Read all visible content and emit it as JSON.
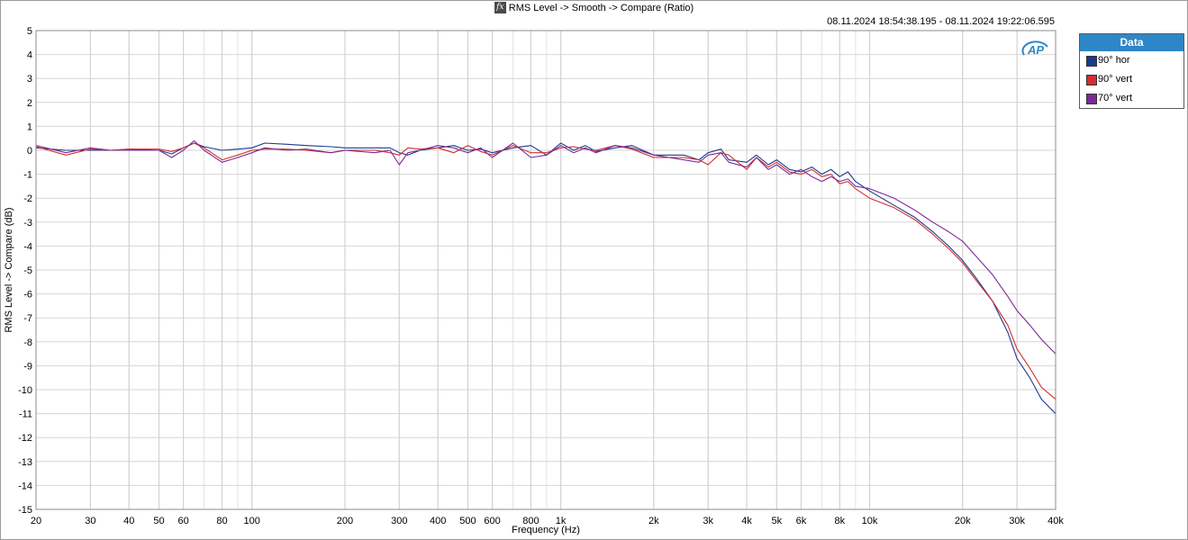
{
  "header": {
    "fx_symbol": "fx",
    "title": "RMS Level -> Smooth -> Compare (Ratio)",
    "timestamp": "08.11.2024 18:54:38.195 - 08.11.2024 19:22:06.595"
  },
  "logo": {
    "text": "AP"
  },
  "legend": {
    "title": "Data",
    "items": [
      {
        "label": "90° hor",
        "color": "#1a3a8c"
      },
      {
        "label": "90° vert",
        "color": "#d32f2f"
      },
      {
        "label": "70° vert",
        "color": "#7b2a96"
      }
    ]
  },
  "chart_data": {
    "type": "line",
    "xlabel": "Frequency (Hz)",
    "ylabel": "RMS Level -> Compare (dB)",
    "xscale": "log",
    "xlim": [
      20,
      40000
    ],
    "ylim": [
      -15,
      5
    ],
    "grid": true,
    "legend_position": "right",
    "x_ticks": [
      {
        "v": 20,
        "label": "20"
      },
      {
        "v": 30,
        "label": "30"
      },
      {
        "v": 40,
        "label": "40"
      },
      {
        "v": 50,
        "label": "50"
      },
      {
        "v": 60,
        "label": "60"
      },
      {
        "v": 80,
        "label": "80"
      },
      {
        "v": 100,
        "label": "100"
      },
      {
        "v": 200,
        "label": "200"
      },
      {
        "v": 300,
        "label": "300"
      },
      {
        "v": 400,
        "label": "400"
      },
      {
        "v": 500,
        "label": "500"
      },
      {
        "v": 600,
        "label": "600"
      },
      {
        "v": 800,
        "label": "800"
      },
      {
        "v": 1000,
        "label": "1k"
      },
      {
        "v": 2000,
        "label": "2k"
      },
      {
        "v": 3000,
        "label": "3k"
      },
      {
        "v": 4000,
        "label": "4k"
      },
      {
        "v": 5000,
        "label": "5k"
      },
      {
        "v": 6000,
        "label": "6k"
      },
      {
        "v": 8000,
        "label": "8k"
      },
      {
        "v": 10000,
        "label": "10k"
      },
      {
        "v": 20000,
        "label": "20k"
      },
      {
        "v": 30000,
        "label": "30k"
      },
      {
        "v": 40000,
        "label": "40k"
      }
    ],
    "y_ticks": [
      5,
      4,
      3,
      2,
      1,
      0,
      -1,
      -2,
      -3,
      -4,
      -5,
      -6,
      -7,
      -8,
      -9,
      -10,
      -11,
      -12,
      -13,
      -14,
      -15
    ],
    "series": [
      {
        "name": "90° hor",
        "color": "#1a3a8c",
        "x": [
          20,
          25,
          30,
          35,
          40,
          50,
          55,
          60,
          65,
          70,
          80,
          90,
          100,
          110,
          130,
          150,
          180,
          200,
          250,
          280,
          300,
          320,
          350,
          400,
          450,
          500,
          550,
          600,
          700,
          800,
          900,
          1000,
          1100,
          1200,
          1300,
          1500,
          1700,
          2000,
          2500,
          2800,
          3000,
          3300,
          3500,
          4000,
          4300,
          4700,
          5000,
          5500,
          6000,
          6500,
          7000,
          7500,
          8000,
          8500,
          9000,
          10000,
          12000,
          14000,
          16000,
          18000,
          20000,
          22000,
          25000,
          28000,
          30000,
          33000,
          36000,
          40000
        ],
        "y": [
          0.1,
          0.0,
          0.0,
          0.0,
          0.05,
          0.0,
          -0.15,
          0.1,
          0.3,
          0.15,
          0.0,
          0.05,
          0.1,
          0.3,
          0.25,
          0.2,
          0.15,
          0.1,
          0.1,
          0.1,
          -0.1,
          -0.2,
          0.0,
          0.1,
          0.2,
          0.0,
          0.05,
          -0.1,
          0.1,
          0.2,
          -0.2,
          0.3,
          0.0,
          0.2,
          -0.05,
          0.1,
          0.2,
          -0.2,
          -0.2,
          -0.4,
          -0.1,
          0.05,
          -0.4,
          -0.5,
          -0.2,
          -0.6,
          -0.4,
          -0.8,
          -0.9,
          -0.7,
          -1.0,
          -0.8,
          -1.1,
          -0.9,
          -1.3,
          -1.7,
          -2.3,
          -2.8,
          -3.4,
          -4.0,
          -4.6,
          -5.3,
          -6.3,
          -7.6,
          -8.7,
          -9.5,
          -10.4,
          -11.0
        ]
      },
      {
        "name": "90° vert",
        "color": "#d32f2f",
        "x": [
          20,
          25,
          30,
          35,
          40,
          50,
          55,
          60,
          65,
          70,
          80,
          90,
          100,
          110,
          130,
          150,
          180,
          200,
          250,
          280,
          300,
          320,
          350,
          400,
          450,
          500,
          550,
          600,
          700,
          800,
          900,
          1000,
          1100,
          1200,
          1300,
          1500,
          1700,
          2000,
          2500,
          2800,
          3000,
          3300,
          3500,
          4000,
          4300,
          4700,
          5000,
          5500,
          6000,
          6500,
          7000,
          7500,
          8000,
          8500,
          9000,
          10000,
          12000,
          14000,
          16000,
          18000,
          20000,
          22000,
          25000,
          28000,
          30000,
          33000,
          36000,
          40000
        ],
        "y": [
          0.15,
          -0.2,
          0.05,
          0.0,
          0.05,
          0.05,
          -0.05,
          0.1,
          0.3,
          0.1,
          -0.4,
          -0.2,
          0.0,
          0.05,
          0.05,
          0.0,
          -0.1,
          0.0,
          0.0,
          -0.1,
          -0.2,
          0.1,
          0.05,
          0.1,
          -0.1,
          0.2,
          -0.05,
          -0.2,
          0.2,
          -0.1,
          -0.1,
          0.1,
          0.15,
          0.05,
          0.0,
          0.2,
          0.05,
          -0.3,
          -0.3,
          -0.4,
          -0.6,
          -0.1,
          -0.2,
          -0.8,
          -0.3,
          -0.7,
          -0.5,
          -0.9,
          -1.0,
          -0.8,
          -1.1,
          -1.0,
          -1.4,
          -1.3,
          -1.6,
          -2.0,
          -2.4,
          -2.9,
          -3.5,
          -4.1,
          -4.7,
          -5.4,
          -6.3,
          -7.3,
          -8.3,
          -9.1,
          -9.9,
          -10.4
        ]
      },
      {
        "name": "70° vert",
        "color": "#7b2a96",
        "x": [
          20,
          25,
          30,
          35,
          40,
          50,
          55,
          60,
          65,
          70,
          80,
          90,
          100,
          110,
          130,
          150,
          180,
          200,
          250,
          280,
          300,
          320,
          350,
          400,
          450,
          500,
          550,
          600,
          700,
          800,
          900,
          1000,
          1100,
          1200,
          1300,
          1500,
          1700,
          2000,
          2500,
          2800,
          3000,
          3300,
          3500,
          4000,
          4300,
          4700,
          5000,
          5500,
          6000,
          6500,
          7000,
          7500,
          8000,
          8500,
          9000,
          10000,
          12000,
          14000,
          16000,
          18000,
          20000,
          22000,
          25000,
          28000,
          30000,
          33000,
          36000,
          40000
        ],
        "y": [
          0.2,
          -0.1,
          0.1,
          0.0,
          0.0,
          0.0,
          -0.3,
          0.0,
          0.4,
          0.0,
          -0.5,
          -0.3,
          -0.1,
          0.1,
          0.0,
          0.05,
          -0.1,
          0.0,
          -0.1,
          0.0,
          -0.6,
          -0.1,
          0.0,
          0.2,
          0.1,
          -0.1,
          0.1,
          -0.3,
          0.3,
          -0.3,
          -0.2,
          0.2,
          -0.1,
          0.1,
          -0.1,
          0.2,
          0.1,
          -0.2,
          -0.4,
          -0.5,
          -0.2,
          -0.1,
          -0.5,
          -0.7,
          -0.3,
          -0.8,
          -0.6,
          -1.0,
          -0.8,
          -1.1,
          -1.3,
          -1.1,
          -1.3,
          -1.2,
          -1.5,
          -1.6,
          -2.0,
          -2.5,
          -3.0,
          -3.4,
          -3.8,
          -4.4,
          -5.2,
          -6.1,
          -6.7,
          -7.3,
          -7.9,
          -8.5
        ]
      }
    ]
  }
}
